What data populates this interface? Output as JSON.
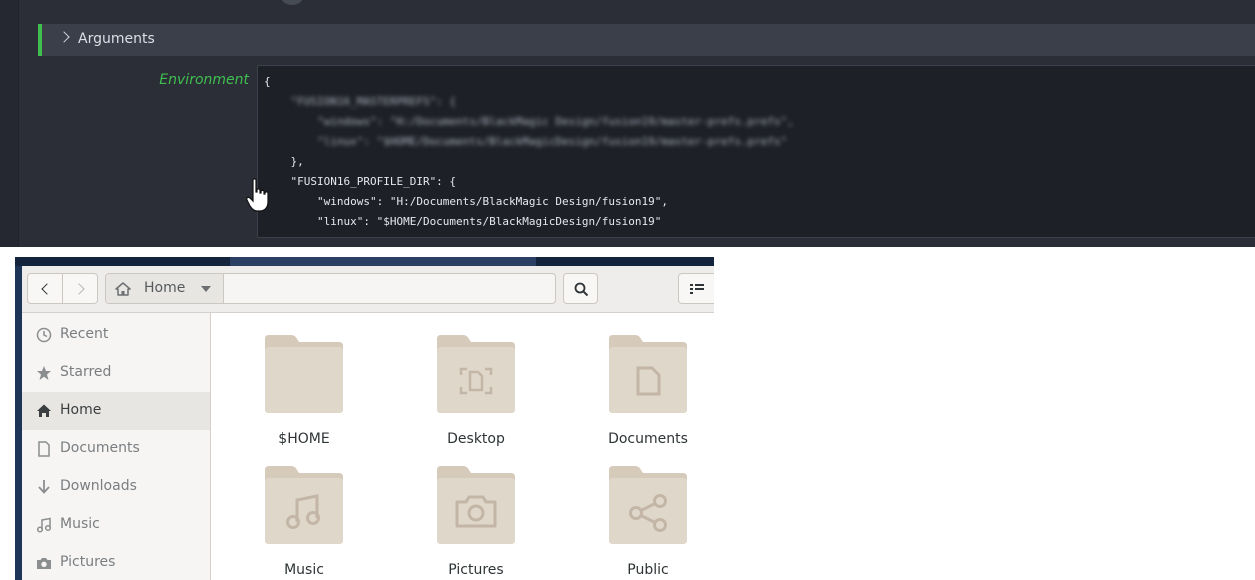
{
  "editor": {
    "section_label": "Arguments",
    "env_label": "Environment",
    "code_lines": [
      "{",
      "    \"FUSION16_MASTERPREFS\": {",
      "        \"windows\": \"H:/Documents/BlackMagic Design/fusion19/master-prefs.prefs\",",
      "        \"linux\": \"$HOME/Documents/BlackMagicDesign/fusion19/master-prefs.prefs\"",
      "    },",
      "    \"FUSION16_PROFILE_DIR\": {",
      "        \"windows\": \"H:/Documents/BlackMagic Design/fusion19\",",
      "        \"linux\": \"$HOME/Documents/BlackMagicDesign/fusion19\""
    ],
    "accent_color": "#3fbf4f"
  },
  "file_manager": {
    "path": {
      "home_label": "Home",
      "icon": "home-icon"
    },
    "toolbar": {
      "search_icon": "search-icon",
      "view_icon": "list-view-icon"
    },
    "sidebar": [
      {
        "label": "Recent",
        "icon": "clock-icon"
      },
      {
        "label": "Starred",
        "icon": "star-icon"
      },
      {
        "label": "Home",
        "icon": "home-icon",
        "active": true
      },
      {
        "label": "Documents",
        "icon": "document-icon"
      },
      {
        "label": "Downloads",
        "icon": "download-icon"
      },
      {
        "label": "Music",
        "icon": "music-icon"
      },
      {
        "label": "Pictures",
        "icon": "camera-icon"
      }
    ],
    "folders": [
      {
        "label": "$HOME",
        "emblem": "none"
      },
      {
        "label": "Desktop",
        "emblem": "desktop"
      },
      {
        "label": "Documents",
        "emblem": "document"
      },
      {
        "label": "Music",
        "emblem": "music"
      },
      {
        "label": "Pictures",
        "emblem": "camera"
      },
      {
        "label": "Public",
        "emblem": "share"
      }
    ],
    "folder_color": "#ddd3c6"
  }
}
